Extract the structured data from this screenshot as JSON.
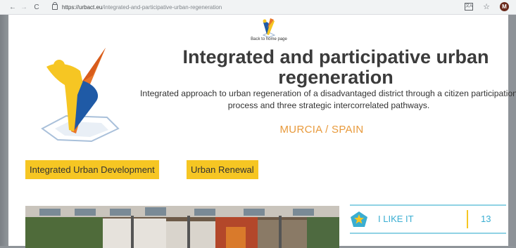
{
  "browser": {
    "url_prefix": "https://urbact.eu",
    "url_path": "/integrated-and-participative-urban-regeneration",
    "back": "←",
    "forward": "→",
    "reload": "C",
    "translate": "文A",
    "star": "☆",
    "profile_initial": "M"
  },
  "header": {
    "home_link": "Back to home page"
  },
  "project": {
    "title": "Integrated and participative urban regeneration",
    "subtitle": "Integrated approach to urban regeneration of a disadvantaged district through a citizen participation process and three strategic intercorrelated pathways.",
    "location": "MURCIA / SPAIN"
  },
  "tags": [
    "Integrated Urban Development",
    "Urban Renewal"
  ],
  "like": {
    "label": "I LIKE IT",
    "count": "13"
  },
  "colors": {
    "accent_yellow": "#f6c623",
    "accent_orange": "#e89a3c",
    "accent_blue": "#3aaed2"
  }
}
